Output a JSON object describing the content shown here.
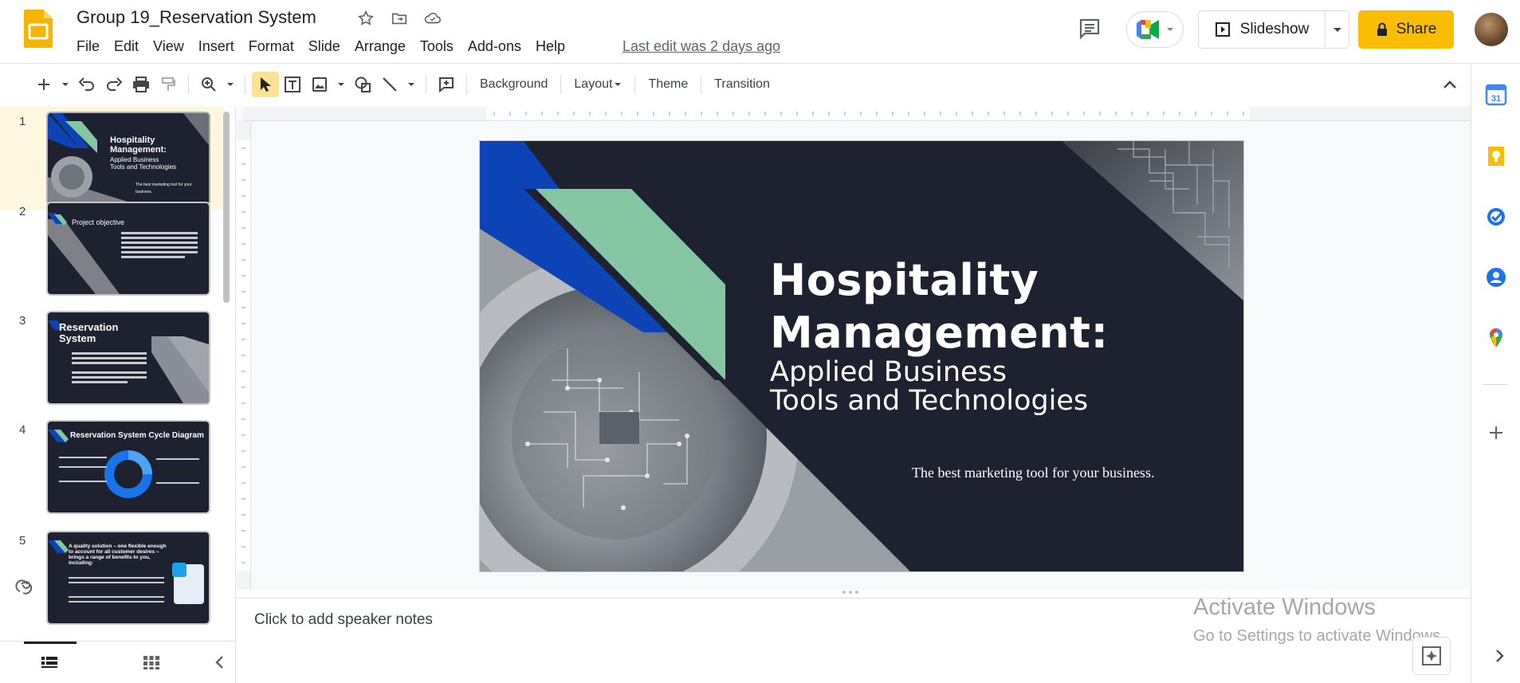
{
  "app": {
    "doc_title": "Group 19_Reservation System",
    "last_edit": "Last edit was 2 days ago"
  },
  "menu": [
    "File",
    "Edit",
    "View",
    "Insert",
    "Format",
    "Slide",
    "Arrange",
    "Tools",
    "Add-ons",
    "Help"
  ],
  "header": {
    "slideshow_label": "Slideshow",
    "share_label": "Share"
  },
  "toolbar": {
    "background": "Background",
    "layout": "Layout",
    "theme": "Theme",
    "transition": "Transition"
  },
  "slides": [
    {
      "num": "1",
      "title": "Hospitality Management:",
      "sub": "Applied Business Tools and Technologies",
      "tag": "The best marketing tool for your business."
    },
    {
      "num": "2",
      "title": "Project objective"
    },
    {
      "num": "3",
      "title": "Reservation System"
    },
    {
      "num": "4",
      "title": "Reservation System Cycle Diagram"
    },
    {
      "num": "5",
      "title": "A quality solution – one flexible enough to account for all customer desires – brings a range of benefits to you, including:"
    }
  ],
  "current_slide": {
    "title_line1": "Hospitality",
    "title_line2": "Management:",
    "sub_line1": "Applied Business",
    "sub_line2": "Tools and Technologies",
    "tagline": "The best marketing tool for your business."
  },
  "notes": {
    "placeholder": "Click to add speaker notes"
  },
  "watermark": {
    "line1": "Activate Windows",
    "line2": "Go to Settings to activate Windows."
  },
  "colors": {
    "share_bg": "#fbbc04",
    "slide_bg": "#1e2130",
    "slide_blue": "#0c44b8",
    "slide_green": "#85c6a2",
    "active_thumb_bg": "#fef7e0"
  }
}
